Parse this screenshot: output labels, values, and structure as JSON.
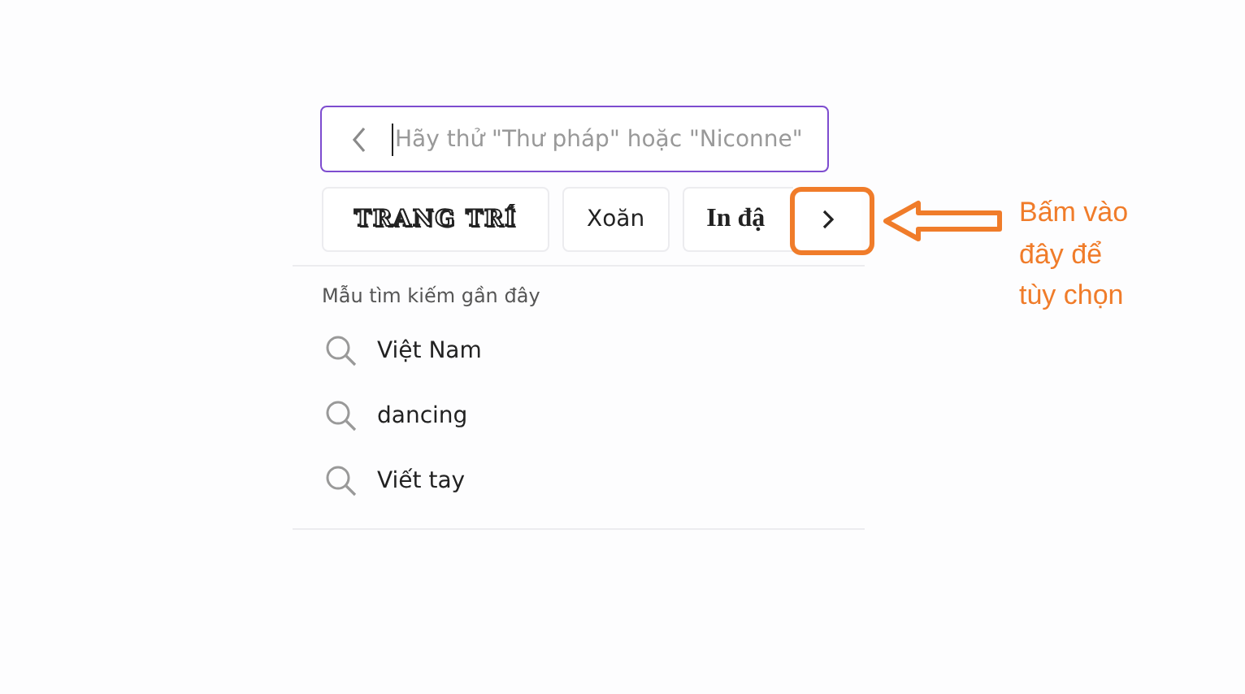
{
  "search": {
    "placeholder": "Hãy thử \"Thư pháp\" hoặc \"Niconne\""
  },
  "chips": [
    {
      "label": "TRANG TRÍ",
      "kind": "decorative"
    },
    {
      "label": "Xoăn",
      "kind": "plain"
    },
    {
      "label": "In đậ",
      "kind": "bold"
    }
  ],
  "recent": {
    "heading": "Mẫu tìm kiếm gần đây",
    "items": [
      "Việt Nam",
      "dancing",
      "Viết tay"
    ]
  },
  "annotation": {
    "text": "Bấm vào đây để tùy chọn"
  }
}
